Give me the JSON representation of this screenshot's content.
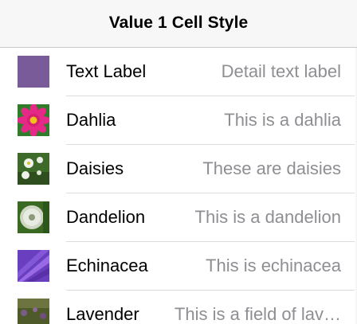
{
  "nav": {
    "title": "Value 1 Cell Style"
  },
  "rows": [
    {
      "label": "Text Label",
      "detail": "Detail text label",
      "icon": "purple-swatch-icon",
      "color": "#7e60a0"
    },
    {
      "label": "Dahlia",
      "detail": "This is a dahlia",
      "icon": "dahlia-photo",
      "color": "#e0287a"
    },
    {
      "label": "Daisies",
      "detail": "These are daisies",
      "icon": "daisies-photo",
      "color": "#4c7a2e"
    },
    {
      "label": "Dandelion",
      "detail": "This is a dandelion",
      "icon": "dandelion-photo",
      "color": "#3e6b25"
    },
    {
      "label": "Echinacea",
      "detail": "This is echinacea",
      "icon": "echinacea-photo",
      "color": "#7a4ad0"
    },
    {
      "label": "Lavender",
      "detail": "This is a field of lav…",
      "icon": "lavender-photo",
      "color": "#5a5a30"
    }
  ]
}
